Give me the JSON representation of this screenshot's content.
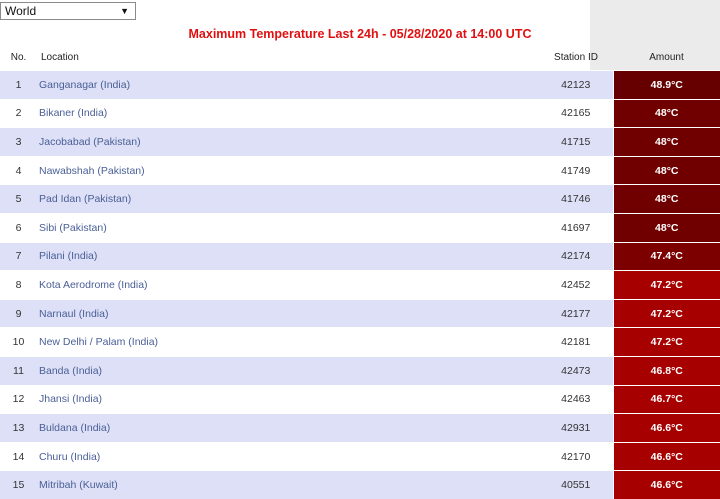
{
  "region": {
    "selected": "World"
  },
  "header": {
    "title": "Maximum Temperature Last 24h - 05/28/2020 at 14:00 UTC"
  },
  "table": {
    "columns": {
      "no": "No.",
      "location": "Location",
      "station_id": "Station ID",
      "amount": "Amount"
    },
    "rows": [
      {
        "no": "1",
        "location": "Ganganagar (India)",
        "station_id": "42123",
        "amount": "48.9°C",
        "color": "#660000"
      },
      {
        "no": "2",
        "location": "Bikaner (India)",
        "station_id": "42165",
        "amount": "48°C",
        "color": "#700000"
      },
      {
        "no": "3",
        "location": "Jacobabad (Pakistan)",
        "station_id": "41715",
        "amount": "48°C",
        "color": "#700000"
      },
      {
        "no": "4",
        "location": "Nawabshah (Pakistan)",
        "station_id": "41749",
        "amount": "48°C",
        "color": "#700000"
      },
      {
        "no": "5",
        "location": "Pad Idan (Pakistan)",
        "station_id": "41746",
        "amount": "48°C",
        "color": "#700000"
      },
      {
        "no": "6",
        "location": "Sibi (Pakistan)",
        "station_id": "41697",
        "amount": "48°C",
        "color": "#700000"
      },
      {
        "no": "7",
        "location": "Pilani (India)",
        "station_id": "42174",
        "amount": "47.4°C",
        "color": "#7d0000"
      },
      {
        "no": "8",
        "location": "Kota Aerodrome (India)",
        "station_id": "42452",
        "amount": "47.2°C",
        "color": "#a60000"
      },
      {
        "no": "9",
        "location": "Narnaul (India)",
        "station_id": "42177",
        "amount": "47.2°C",
        "color": "#a60000"
      },
      {
        "no": "10",
        "location": "New Delhi / Palam (India)",
        "station_id": "42181",
        "amount": "47.2°C",
        "color": "#a60000"
      },
      {
        "no": "11",
        "location": "Banda (India)",
        "station_id": "42473",
        "amount": "46.8°C",
        "color": "#a60000"
      },
      {
        "no": "12",
        "location": "Jhansi (India)",
        "station_id": "42463",
        "amount": "46.7°C",
        "color": "#a60000"
      },
      {
        "no": "13",
        "location": "Buldana (India)",
        "station_id": "42931",
        "amount": "46.6°C",
        "color": "#a60000"
      },
      {
        "no": "14",
        "location": "Churu (India)",
        "station_id": "42170",
        "amount": "46.6°C",
        "color": "#a60000"
      },
      {
        "no": "15",
        "location": "Mitribah (Kuwait)",
        "station_id": "40551",
        "amount": "46.6°C",
        "color": "#a60000"
      }
    ]
  }
}
